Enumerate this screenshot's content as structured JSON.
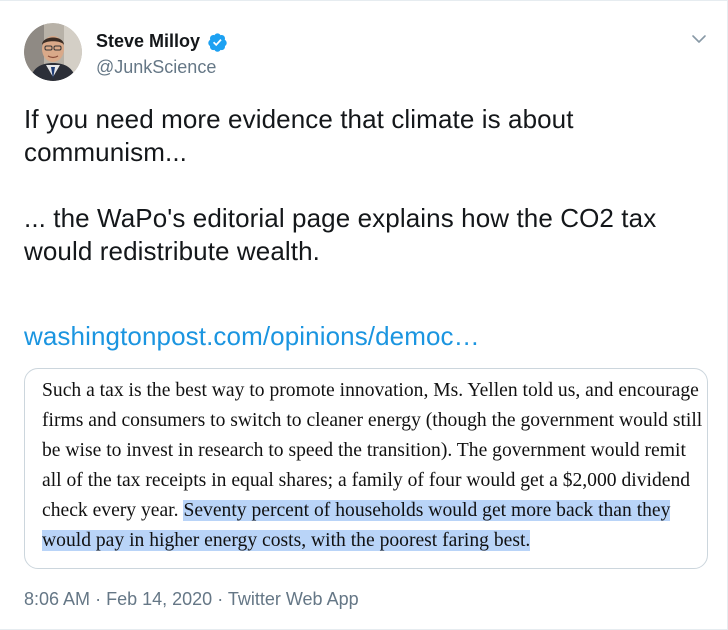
{
  "author": {
    "name": "Steve Milloy",
    "handle": "@JunkScience"
  },
  "tweet": {
    "text": "If you need more evidence that climate is about communism...\n\n... the WaPo's editorial page explains how the CO2 tax would redistribute wealth.",
    "link": "washingtonpost.com/opinions/democ…"
  },
  "quote_card": {
    "normal_text": "Such a tax is the best way to promote innovation, Ms. Yellen told us, and encourage firms and consumers to switch to cleaner energy (though the government would still be wise to invest in research to speed the transition). The government would remit all of the tax receipts in equal shares; a family of four would get a $2,000 dividend check every year. ",
    "highlighted_text": "Seventy percent of households would get more back than they would pay in higher energy costs, with the poorest faring best."
  },
  "meta": {
    "time": "8:06 AM",
    "separator": "·",
    "date": "Feb 14, 2020",
    "source": "Twitter Web App"
  },
  "colors": {
    "link": "#1b95e0",
    "verified_badge": "#1da1f2",
    "highlight": "#b9d4f8",
    "secondary_text": "#657786"
  },
  "icons": {
    "verified": "verified-badge-icon",
    "menu": "chevron-down-icon"
  }
}
